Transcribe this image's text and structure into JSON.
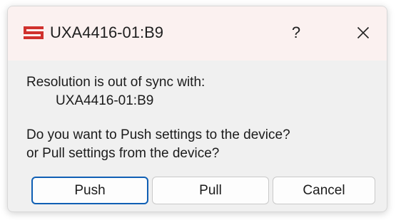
{
  "window": {
    "title": "UXA4416-01:B9",
    "icon": "app-logo-icon",
    "help_label": "?",
    "close_icon": "close-icon"
  },
  "message": {
    "line1": "Resolution is out of sync with:",
    "device": "UXA4416-01:B9",
    "line3": "Do you want to Push settings to the device?",
    "line4": "or Pull settings from the device?"
  },
  "buttons": {
    "push": "Push",
    "pull": "Pull",
    "cancel": "Cancel"
  },
  "colors": {
    "titlebar": "#fbf1f0",
    "icon": "#d0312d",
    "default_border": "#0f5fb4"
  }
}
